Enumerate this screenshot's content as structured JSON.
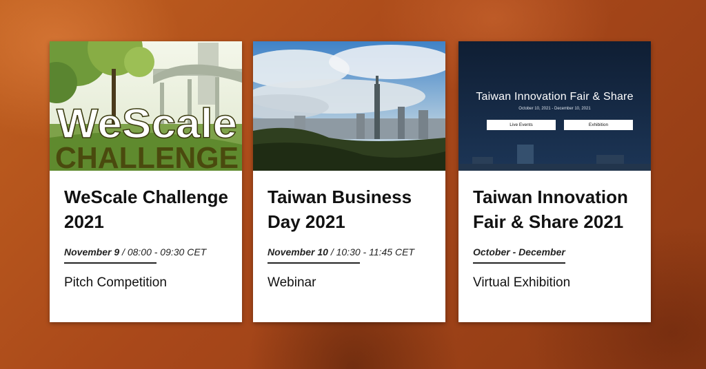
{
  "cards": [
    {
      "image_title_line1": "WeScale",
      "image_title_line2": "CHALLENGE",
      "title": "WeScale Challenge 2021",
      "date": "November 9",
      "time": " / 08:00 - 09:30 CET",
      "type": "Pitch Competition"
    },
    {
      "title": "Taiwan Business Day 2021",
      "date": "November 10",
      "time": " / 10:30 - 11:45 CET",
      "type": "Webinar"
    },
    {
      "image_title": "Taiwan Innovation Fair & Share",
      "image_dates": "October 10, 2021 - December 10, 2021",
      "image_buttons": [
        "Live Events",
        "Exhibition"
      ],
      "title": "Taiwan Innovation Fair & Share 2021",
      "date": "October - December",
      "time": "",
      "type": "Virtual Exhibition"
    }
  ]
}
